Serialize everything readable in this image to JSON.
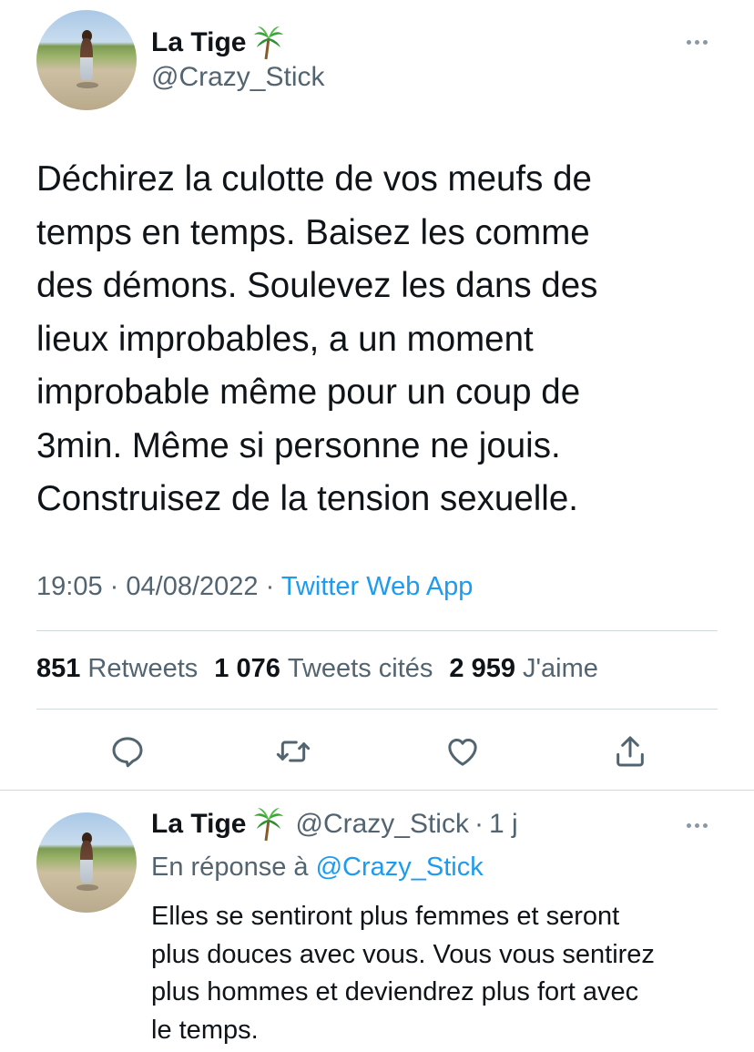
{
  "main_tweet": {
    "author": {
      "display_name": "La Tige",
      "badge_icon": "palm-tree-emoji",
      "handle": "@Crazy_Stick"
    },
    "text": "Déchirez la culotte de vos meufs de\ntemps en temps. Baisez les comme\ndes démons. Soulevez les dans des\nlieux improbables, a un moment\nimprobable même pour un coup de\n3min. Même si personne ne jouis.\nConstruisez de la tension sexuelle.",
    "time": "19:05",
    "date": "04/08/2022",
    "separator": "·",
    "source": "Twitter Web App",
    "stats": {
      "retweets_count": "851",
      "retweets_label": "Retweets",
      "quotes_count": "1 076",
      "quotes_label": "Tweets cités",
      "likes_count": "2 959",
      "likes_label": "J'aime"
    },
    "actions": [
      "reply-icon",
      "retweet-icon",
      "like-icon",
      "share-icon"
    ]
  },
  "reply_tweet": {
    "author": {
      "display_name": "La Tige",
      "badge_icon": "palm-tree-emoji",
      "handle": "@Crazy_Stick",
      "time_ago": "1 j",
      "separator": "·"
    },
    "replying_to_label": "En réponse à",
    "replying_to_handle": "@Crazy_Stick",
    "text": "Elles se sentiront plus femmes et seront\nplus douces avec vous. Vous vous sentirez\nplus hommes et deviendrez plus fort avec\nle temps."
  },
  "colors": {
    "text": "#0f1419",
    "secondary": "#536471",
    "link": "#1d9bf0",
    "divider": "#cfd9de"
  }
}
